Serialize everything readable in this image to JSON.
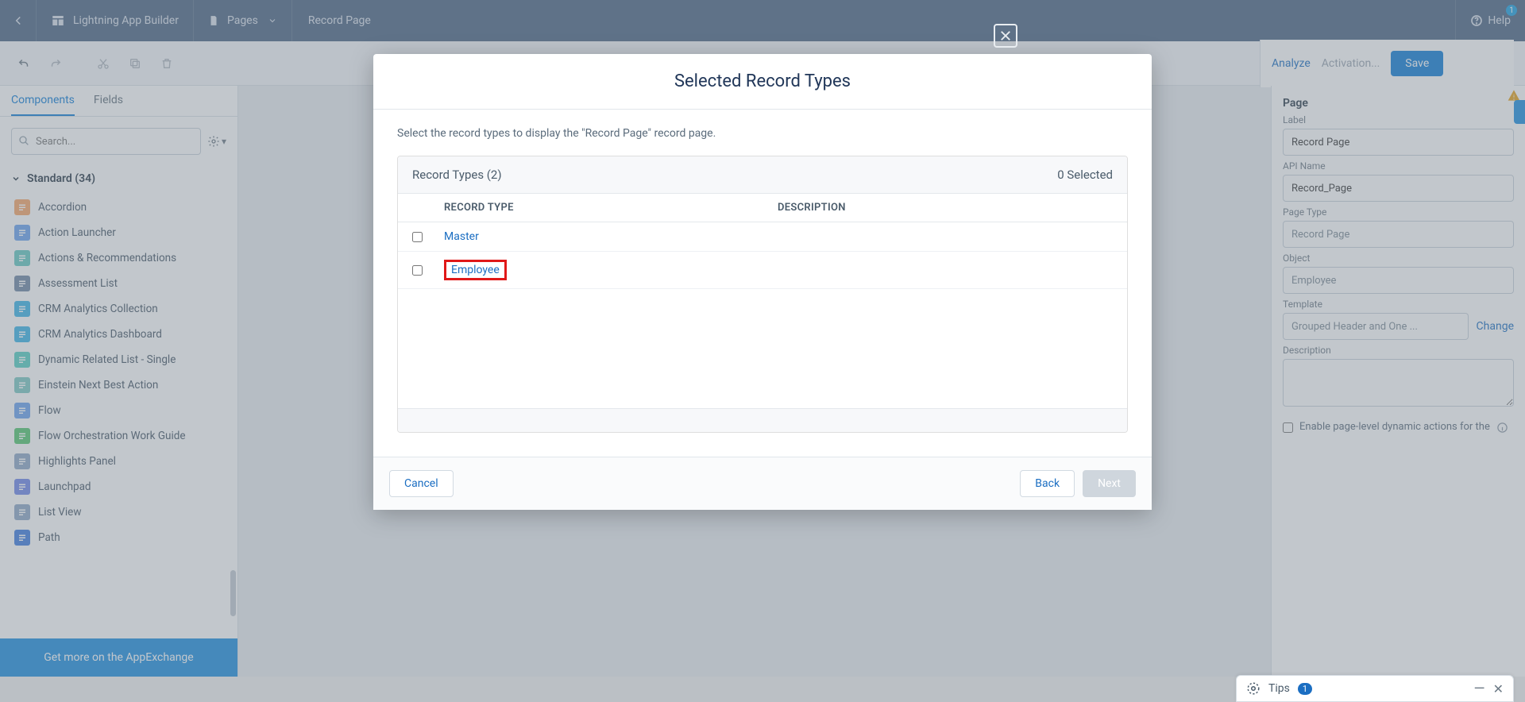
{
  "topbar": {
    "app_title": "Lightning App Builder",
    "pages_label": "Pages",
    "record_title": "Record Page",
    "help_label": "Help",
    "help_badge": "1"
  },
  "toolbar": {
    "analyze": "Analyze",
    "activation": "Activation...",
    "save": "Save"
  },
  "left": {
    "tabs": {
      "components": "Components",
      "fields": "Fields"
    },
    "search_placeholder": "Search...",
    "group_title": "Standard (34)",
    "components": [
      {
        "label": "Accordion",
        "color": "#f7a668"
      },
      {
        "label": "Action Launcher",
        "color": "#6aa2ef"
      },
      {
        "label": "Actions & Recommendations",
        "color": "#64c8c2"
      },
      {
        "label": "Assessment List",
        "color": "#6f87a5"
      },
      {
        "label": "CRM Analytics Collection",
        "color": "#3bb5e8"
      },
      {
        "label": "CRM Analytics Dashboard",
        "color": "#3bb5e8"
      },
      {
        "label": "Dynamic Related List - Single",
        "color": "#56d0c4"
      },
      {
        "label": "Einstein Next Best Action",
        "color": "#7cc9c3"
      },
      {
        "label": "Flow",
        "color": "#6aa2ef"
      },
      {
        "label": "Flow Orchestration Work Guide",
        "color": "#54c66f"
      },
      {
        "label": "Highlights Panel",
        "color": "#8fa8c6"
      },
      {
        "label": "Launchpad",
        "color": "#6f87ea"
      },
      {
        "label": "List View",
        "color": "#8fa8c6"
      },
      {
        "label": "Path",
        "color": "#3f7de0"
      }
    ],
    "appexchange": "Get more on the AppExchange"
  },
  "right": {
    "page": "Page",
    "label_l": "Label",
    "label_v": "Record Page",
    "api_l": "API Name",
    "api_v": "Record_Page",
    "type_l": "Page Type",
    "type_v": "Record Page",
    "obj_l": "Object",
    "obj_v": "Employee",
    "tpl_l": "Template",
    "tpl_v": "Grouped Header and One ...",
    "change": "Change",
    "desc_l": "Description",
    "dyn_l": "Enable page-level dynamic actions for the"
  },
  "modal": {
    "title": "Selected Record Types",
    "subtitle": "Select the record types to display the \"Record Page\" record page.",
    "box_title": "Record Types (2)",
    "selected_text": "0 Selected",
    "col_record_type": "Record Type",
    "col_description": "Description",
    "rows": [
      {
        "name": "Master",
        "description": ""
      },
      {
        "name": "Employee",
        "description": ""
      }
    ],
    "cancel": "Cancel",
    "back": "Back",
    "next": "Next"
  },
  "tips": {
    "label": "Tips",
    "count": "1"
  }
}
